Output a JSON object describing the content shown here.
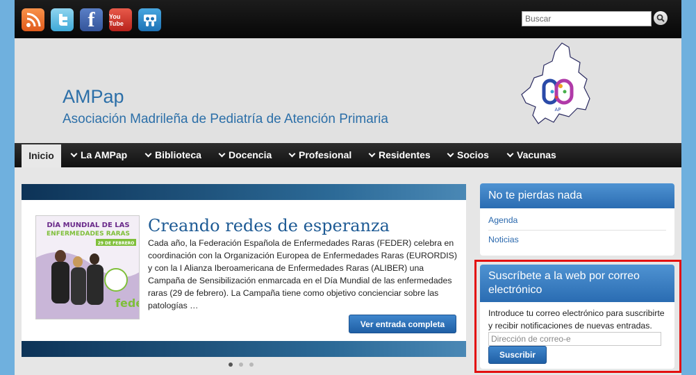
{
  "topbar": {
    "social": [
      {
        "icon": "rss-icon"
      },
      {
        "icon": "twitter-icon"
      },
      {
        "icon": "facebook-icon",
        "glyph": "f"
      },
      {
        "icon": "youtube-icon",
        "glyph": "You Tube"
      },
      {
        "icon": "slideshare-icon"
      }
    ],
    "search_placeholder": "Buscar"
  },
  "header": {
    "title": "AMPap",
    "description": "Asociación Madrileña de Pediatría de Atención Primaria",
    "logo_text": "AP"
  },
  "nav": {
    "items": [
      {
        "label": "Inicio",
        "active": true
      },
      {
        "label": "La AMPap"
      },
      {
        "label": "Biblioteca"
      },
      {
        "label": "Docencia"
      },
      {
        "label": "Profesional"
      },
      {
        "label": "Residentes"
      },
      {
        "label": "Socios"
      },
      {
        "label": "Vacunas"
      }
    ]
  },
  "slider": {
    "poster": {
      "line1": "DÍA MUNDIAL DE LAS",
      "line2": "ENFERMEDADES RARAS",
      "date": "29 DE FEBRERO",
      "brand": "feder"
    },
    "title": "Creando redes de esperanza",
    "text": "Cada año, la Federación Española de Enfermedades Raras (FEDER) celebra en coordinación con la Organización Europea de Enfermedades Raras (EURORDIS) y con la I Alianza Iberoamericana de Enfermedades Raras (ALIBER) una Campaña de Sensibilización enmarcada en el Día Mundial de las enfermedades raras (29 de febrero). La Campaña tiene como objetivo concienciar sobre las patologías …",
    "more_label": "Ver entrada completa",
    "dots": 3,
    "active_dot": 0
  },
  "sidebar": {
    "widget1": {
      "title": "No te pierdas nada",
      "links": [
        "Agenda",
        "Noticias"
      ]
    },
    "widget2": {
      "title": "Suscríbete a la web por correo electrónico",
      "text": "Introduce tu correo electrónico para suscribirte y recibir notificaciones de nuevas entradas.",
      "email_placeholder": "Dirección de correo-e",
      "button_label": "Suscribir"
    }
  },
  "colors": {
    "accent": "#2c6fa8",
    "highlight": "#e31010"
  }
}
